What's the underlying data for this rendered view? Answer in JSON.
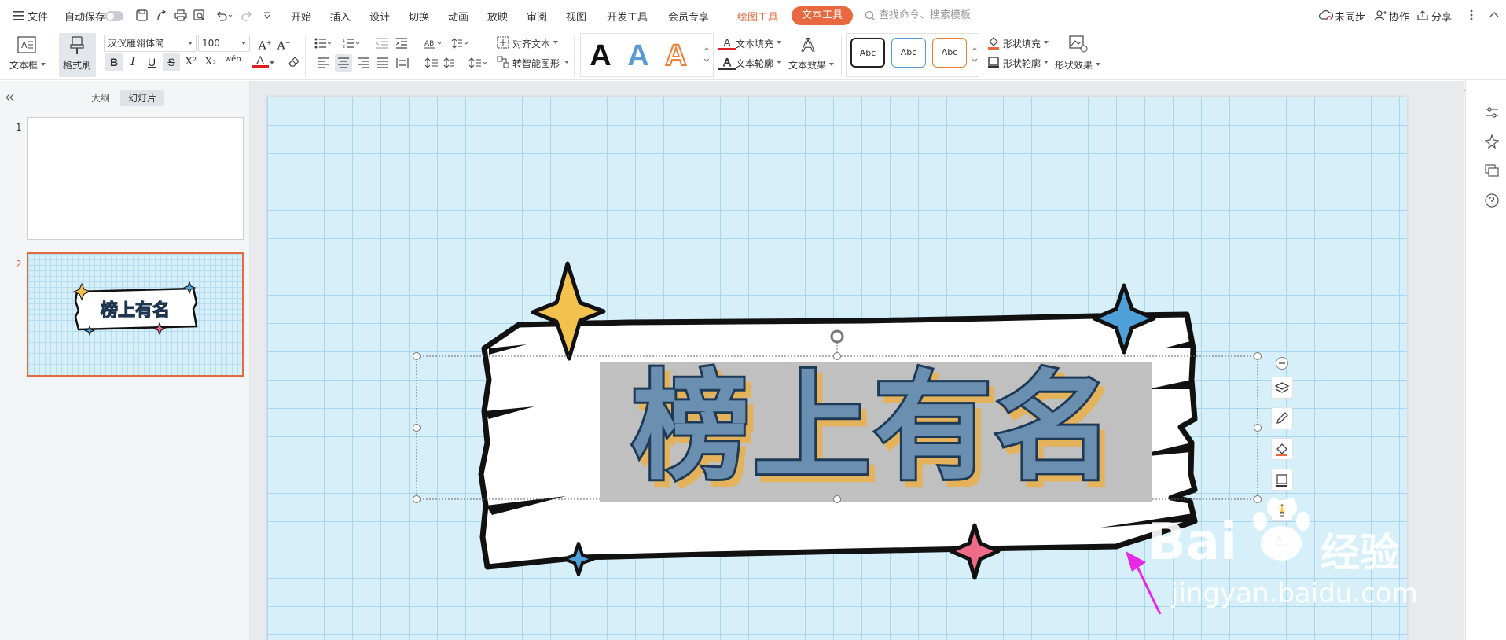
{
  "menubar": {
    "file": "文件",
    "autosave": "自动保存",
    "tabs": [
      "开始",
      "插入",
      "设计",
      "切换",
      "动画",
      "放映",
      "审阅",
      "视图",
      "开发工具",
      "会员专享"
    ],
    "drawing_tools": "绘图工具",
    "text_tools": "文本工具",
    "search_placeholder": "查找命令、搜索模板",
    "unsynced": "未同步",
    "collaborate": "协作",
    "share": "分享"
  },
  "ribbon": {
    "textbox": "文本框",
    "format_painter": "格式刷",
    "font_name": "汉仪雁翎体简",
    "font_size": "100",
    "align_text": "对齐文本",
    "smart_shape": "转智能图形",
    "text_fill": "文本填充",
    "text_outline": "文本轮廓",
    "text_effect": "文本效果",
    "style_letter": "A",
    "abc_label": "Abc",
    "shape_fill": "形状填充",
    "shape_outline": "形状轮廓",
    "shape_effect": "形状效果",
    "bold": "B",
    "italic": "I",
    "underline": "U",
    "strike": "S",
    "superscript": "X²",
    "subscript": "X₂",
    "phonetic": "wén",
    "font_color_letter": "A"
  },
  "leftpanel": {
    "tab_outline": "大纲",
    "tab_slides": "幻灯片",
    "slides": [
      {
        "number": "1"
      },
      {
        "number": "2"
      }
    ]
  },
  "slide": {
    "title_text": "榜上有名"
  },
  "watermark": {
    "brand": "Bai",
    "brand_suffix": "经验",
    "url": "jingyan.baidu.com"
  },
  "colors": {
    "accent": "#e9683f",
    "grid_bg": "#d6eff9",
    "title_fill": "#6b8fb0",
    "title_shadow": "#e3b25a"
  }
}
